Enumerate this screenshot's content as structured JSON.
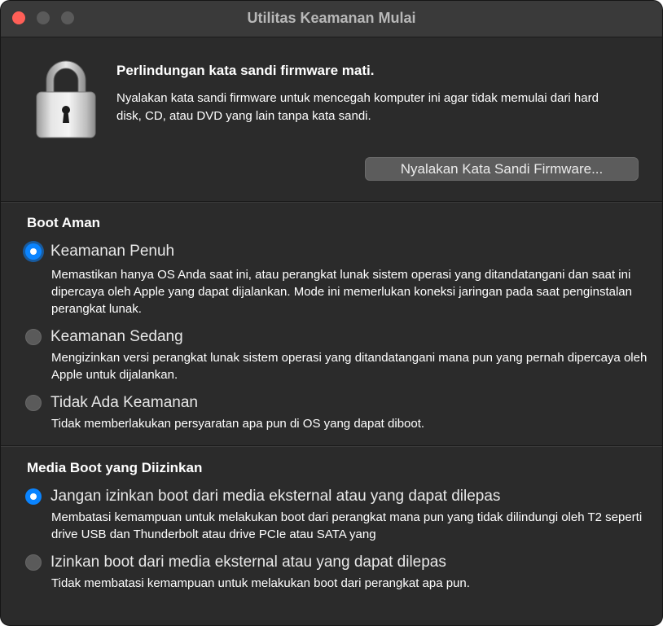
{
  "window": {
    "title": "Utilitas Keamanan Mulai"
  },
  "firmware": {
    "heading": "Perlindungan kata sandi firmware mati.",
    "description": "Nyalakan kata sandi firmware untuk mencegah komputer ini agar tidak memulai dari hard disk, CD, atau DVD yang lain tanpa kata sandi.",
    "button_label": "Nyalakan Kata Sandi Firmware..."
  },
  "secure_boot": {
    "title": "Boot Aman",
    "options": [
      {
        "label": "Keamanan Penuh",
        "selected": true,
        "description": "Memastikan hanya OS Anda saat ini, atau perangkat lunak sistem operasi yang ditandatangani dan saat ini dipercaya oleh Apple yang dapat dijalankan. Mode ini memerlukan koneksi jaringan pada saat penginstalan perangkat lunak."
      },
      {
        "label": "Keamanan Sedang",
        "selected": false,
        "description": "Mengizinkan versi perangkat lunak sistem operasi yang ditandatangani mana pun yang pernah dipercaya oleh Apple untuk dijalankan."
      },
      {
        "label": "Tidak Ada Keamanan",
        "selected": false,
        "description": "Tidak memberlakukan persyaratan apa pun di OS yang dapat diboot."
      }
    ]
  },
  "boot_media": {
    "title": "Media Boot yang Diizinkan",
    "options": [
      {
        "label": "Jangan izinkan boot dari media eksternal atau yang dapat dilepas",
        "selected": true,
        "description": "Membatasi kemampuan untuk melakukan boot dari perangkat mana pun yang tidak dilindungi oleh T2 seperti drive USB dan Thunderbolt atau drive PCIe atau SATA yang"
      },
      {
        "label": "Izinkan boot dari media eksternal atau yang dapat dilepas",
        "selected": false,
        "description": "Tidak membatasi kemampuan untuk melakukan boot dari perangkat apa pun."
      }
    ]
  },
  "icons": {
    "lock": "padlock-icon"
  },
  "colors": {
    "window_bg": "#2b2b2b",
    "accent": "#0a84ff",
    "close": "#ff5f57"
  }
}
